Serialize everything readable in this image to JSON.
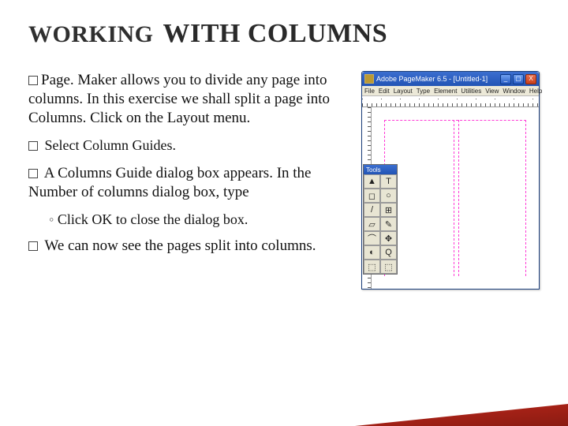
{
  "title": {
    "part1": "WORKING",
    "part2": "WITH COLUMNS"
  },
  "bullets": {
    "b1_lead": "Page. Maker ",
    "b1_rest": "allows you to divide any page into columns. In this exercise we shall split a page into Columns. Click on the Layout menu.",
    "b2": "Select Column Guides.",
    "b3": "A Columns Guide dialog box appears. In the Number of columns dialog box, type",
    "b3_sub": "Click OK to close the dialog box.",
    "b4": "We can now see the pages split into columns."
  },
  "app": {
    "title": "Adobe PageMaker 6.5 - [Untitled-1]",
    "menus": [
      "File",
      "Edit",
      "Layout",
      "Type",
      "Element",
      "Utilities",
      "View",
      "Window",
      "Help"
    ],
    "winbtns": {
      "min": "_",
      "max": "▢",
      "close": "X"
    },
    "toolbox_title": "Tools",
    "tools": [
      "▲",
      "T",
      "◻",
      "○",
      "/",
      "⊞",
      "▱",
      "✎",
      "⌒",
      "✥",
      "◐",
      "Q",
      "⬚",
      "⬚"
    ]
  }
}
